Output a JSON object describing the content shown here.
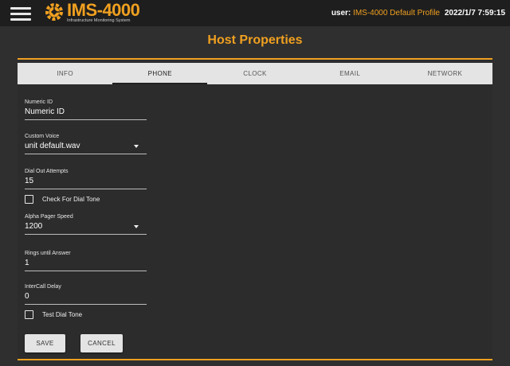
{
  "header": {
    "logo_title": "IMS-4000",
    "logo_subtitle": "Infrastructure Monitoring System",
    "user_label": "user:",
    "user_value": "IMS-4000 Default Profile",
    "datetime": "2022/1/7 7:59:15",
    "brand_color": "#f0a020"
  },
  "page": {
    "title": "Host Properties"
  },
  "tabs": [
    {
      "label": "INFO"
    },
    {
      "label": "PHONE",
      "active": true
    },
    {
      "label": "CLOCK"
    },
    {
      "label": "EMAIL"
    },
    {
      "label": "NETWORK"
    }
  ],
  "form": {
    "numeric_id": {
      "label": "Numeric ID",
      "value": "Numeric ID"
    },
    "custom_voice": {
      "label": "Custom Voice",
      "value": "unit default.wav"
    },
    "dial_out_attempts": {
      "label": "Dial Out Attempts",
      "value": "15"
    },
    "check_dial_tone": {
      "label": "Check For Dial Tone",
      "checked": false
    },
    "alpha_pager_speed": {
      "label": "Alpha Pager Speed",
      "value": "1200"
    },
    "rings_until_answer": {
      "label": "Rings until Answer",
      "value": "1"
    },
    "intercall_delay": {
      "label": "InterCall Delay",
      "value": "0"
    },
    "test_dial_tone": {
      "label": "Test Dial Tone",
      "checked": false
    }
  },
  "actions": {
    "save": "SAVE",
    "cancel": "CANCEL"
  }
}
